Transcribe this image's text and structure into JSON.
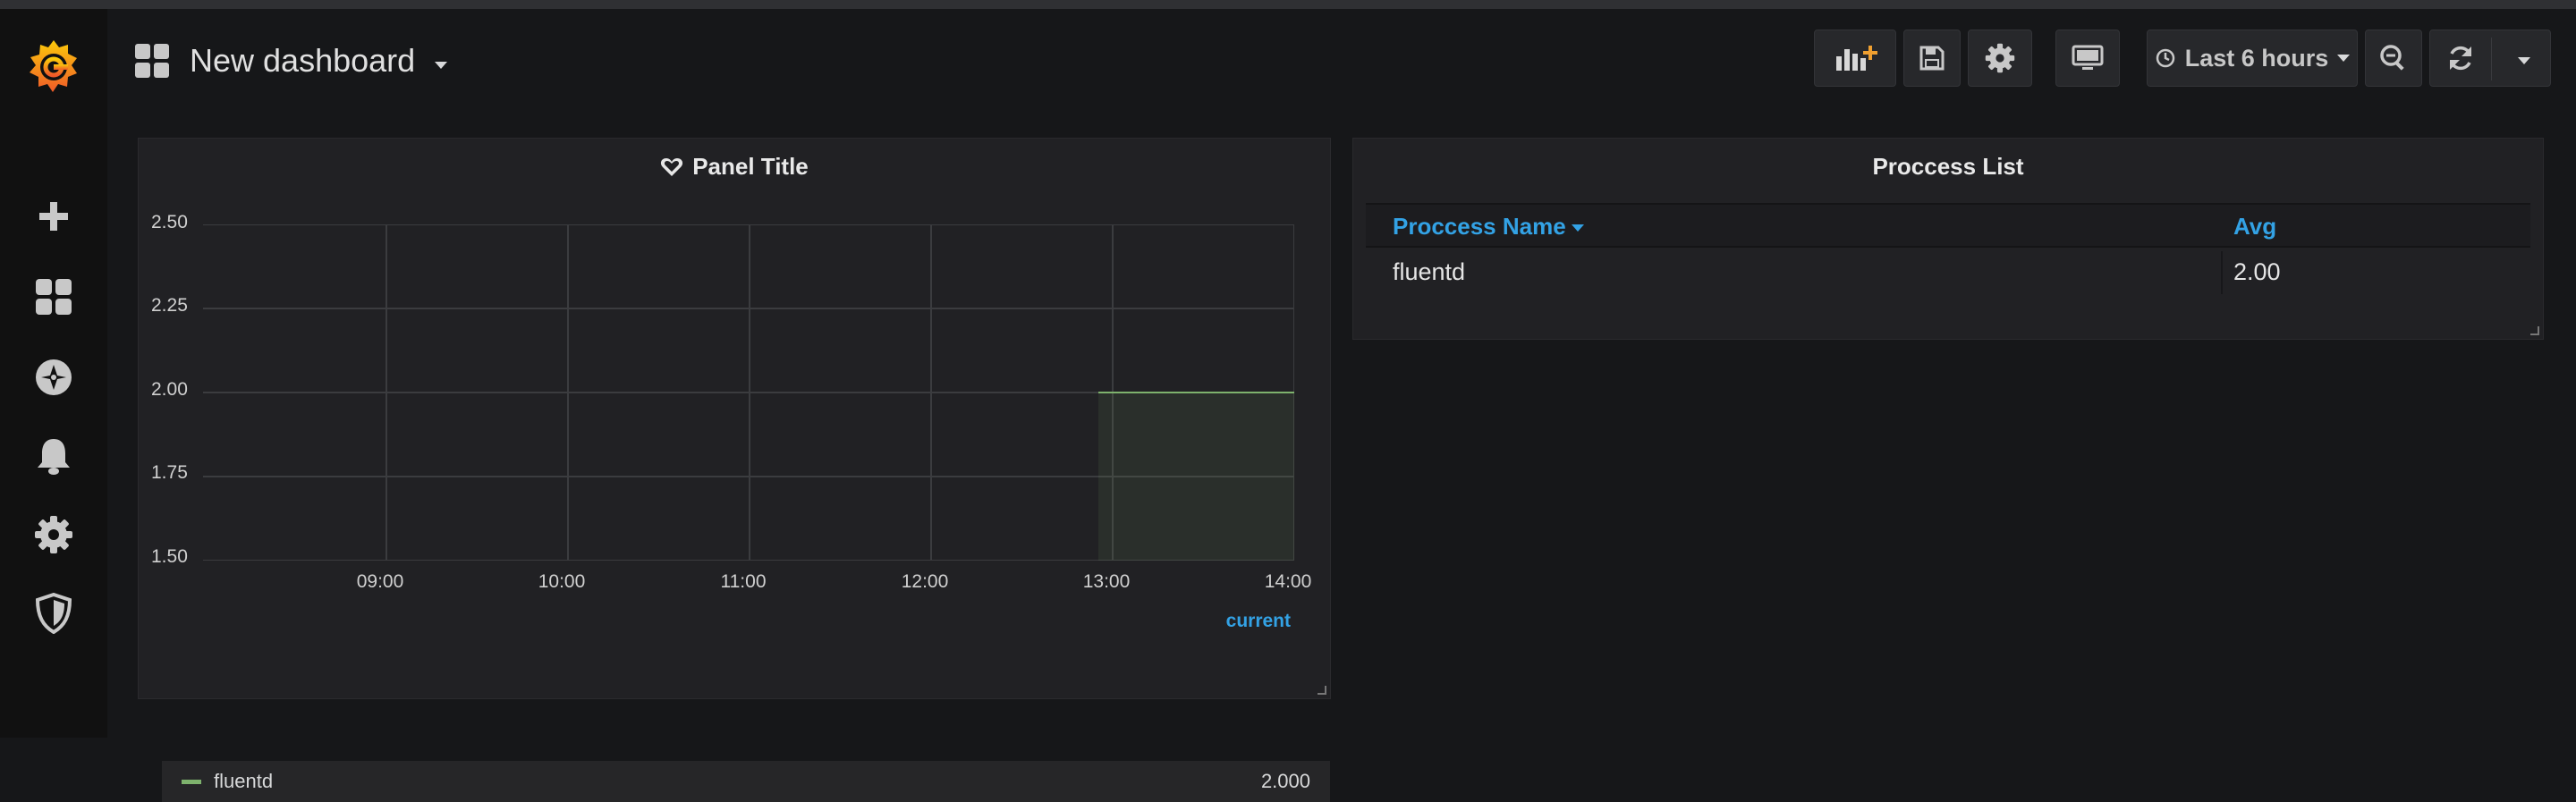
{
  "header": {
    "title": "New dashboard",
    "time_range": "Last 6 hours"
  },
  "sidebar": {
    "items": [
      {
        "name": "create",
        "icon": "plus-icon"
      },
      {
        "name": "dashboards",
        "icon": "grid-icon"
      },
      {
        "name": "explore",
        "icon": "compass-icon"
      },
      {
        "name": "alerting",
        "icon": "bell-icon"
      },
      {
        "name": "configuration",
        "icon": "gear-icon"
      },
      {
        "name": "server-admin",
        "icon": "shield-icon"
      }
    ]
  },
  "graph_panel": {
    "title": "Panel Title",
    "legend_header": "current",
    "legend": [
      {
        "name": "fluentd",
        "value": "2.000",
        "color": "#7eb26d"
      }
    ]
  },
  "table_panel": {
    "title": "Proccess List",
    "columns": [
      "Proccess Name",
      "Avg"
    ],
    "rows": [
      [
        "fluentd",
        "2.00"
      ]
    ]
  },
  "colors": {
    "background": "#161719",
    "panel": "#212124",
    "accent": "#33a2e5",
    "series": "#7eb26d",
    "brand": "#f4682c"
  },
  "chart_data": {
    "type": "line",
    "x": [
      "13:00",
      "14:00"
    ],
    "series": [
      {
        "name": "fluentd",
        "values": [
          2.0,
          2.0
        ]
      }
    ],
    "x_ticks": [
      "09:00",
      "10:00",
      "11:00",
      "12:00",
      "13:00",
      "14:00"
    ],
    "y_ticks": [
      "1.50",
      "1.75",
      "2.00",
      "2.25",
      "2.50"
    ],
    "ylim": [
      1.5,
      2.5
    ],
    "grid": true,
    "fill": true,
    "legend_position": "bottom"
  }
}
